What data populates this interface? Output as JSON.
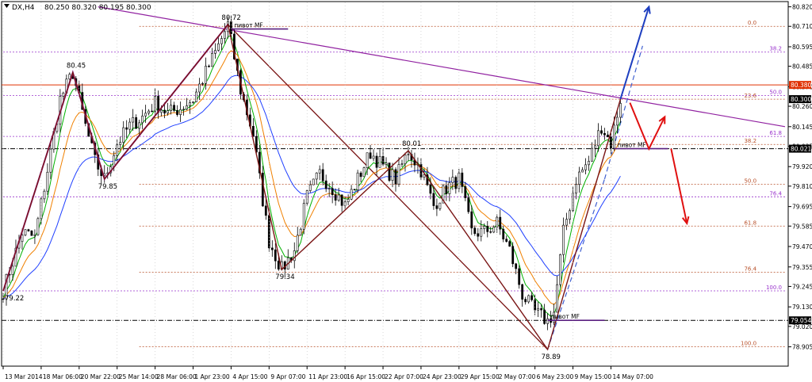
{
  "header": {
    "symbol": "DX,H4",
    "ohlc": "80.250 80.320 80.195 80.300"
  },
  "colors": {
    "background": "#ffffff",
    "candle": "#000000",
    "grid": "#c0c0c0",
    "ma_fast": "#00b000",
    "ma_mid": "#f08000",
    "ma_slow": "#2040ff",
    "zigzag": "#7a1515",
    "purple_line": "#9020a0",
    "fib_brown": "#b8502a",
    "fib_purple": "#9933cc",
    "red_level": "#e03000",
    "black_level": "#000000",
    "forecast_blue": "#1e3fc0",
    "forecast_red": "#e01010"
  },
  "chart_data": {
    "type": "candlestick",
    "title": "DX,H4",
    "ylim": [
      78.805,
      80.845
    ],
    "x_range": [
      0,
      247
    ],
    "y_ticks": [
      80.82,
      80.71,
      80.595,
      80.485,
      80.37,
      80.26,
      80.145,
      80.035,
      79.92,
      79.81,
      79.695,
      79.585,
      79.47,
      79.355,
      79.245,
      79.13,
      79.02,
      78.905,
      78.795
    ],
    "x_ticks": [
      {
        "x": 0,
        "label": "13 Mar 2014"
      },
      {
        "x": 12,
        "label": "18 Mar 06:00"
      },
      {
        "x": 24,
        "label": "20 Mar 22:00"
      },
      {
        "x": 36,
        "label": "25 Mar 14:00"
      },
      {
        "x": 48,
        "label": "28 Mar 06:00"
      },
      {
        "x": 60,
        "label": "1 Apr 23:00"
      },
      {
        "x": 72,
        "label": "4 Apr 15:00"
      },
      {
        "x": 84,
        "label": "9 Apr 07:00"
      },
      {
        "x": 96,
        "label": "11 Apr 23:00"
      },
      {
        "x": 108,
        "label": "16 Apr 15:00"
      },
      {
        "x": 120,
        "label": "22 Apr 07:00"
      },
      {
        "x": 132,
        "label": "24 Apr 23:00"
      },
      {
        "x": 144,
        "label": "29 Apr 15:00"
      },
      {
        "x": 156,
        "label": "2 May 07:00"
      },
      {
        "x": 168,
        "label": "6 May 23:00"
      },
      {
        "x": 180,
        "label": "9 May 15:00"
      },
      {
        "x": 192,
        "label": "14 May 07:00"
      }
    ],
    "price_tags": [
      {
        "value": 80.38,
        "label": "80.380",
        "bg": "#e03000",
        "fg": "#ffffff"
      },
      {
        "value": 80.3,
        "label": "80.300",
        "bg": "#000000",
        "fg": "#ffffff"
      },
      {
        "value": 80.021,
        "label": "80.021",
        "bg": "#000000",
        "fg": "#ffffff"
      },
      {
        "value": 79.054,
        "label": "79.054",
        "bg": "#000000",
        "fg": "#ffffff"
      }
    ],
    "swing_labels": [
      {
        "x": 0,
        "y": 79.22,
        "label": "79.22",
        "pos": "below"
      },
      {
        "x": 22,
        "y": 80.45,
        "label": "80.45",
        "pos": "above"
      },
      {
        "x": 32,
        "y": 79.85,
        "label": "79.85",
        "pos": "below"
      },
      {
        "x": 71,
        "y": 80.72,
        "label": "80.72",
        "pos": "above"
      },
      {
        "x": 88,
        "y": 79.34,
        "label": "79.34",
        "pos": "below"
      },
      {
        "x": 128,
        "y": 80.01,
        "label": "80.01",
        "pos": "above"
      },
      {
        "x": 172,
        "y": 78.89,
        "label": "78.89",
        "pos": "below"
      }
    ],
    "anchors": [
      [
        0,
        79.22
      ],
      [
        6,
        79.55
      ],
      [
        10,
        79.52
      ],
      [
        14,
        79.9
      ],
      [
        18,
        80.3
      ],
      [
        22,
        80.45
      ],
      [
        26,
        80.15
      ],
      [
        29,
        79.95
      ],
      [
        32,
        79.85
      ],
      [
        36,
        80.05
      ],
      [
        40,
        80.15
      ],
      [
        44,
        80.2
      ],
      [
        48,
        80.28
      ],
      [
        52,
        80.22
      ],
      [
        56,
        80.25
      ],
      [
        60,
        80.3
      ],
      [
        64,
        80.45
      ],
      [
        68,
        80.6
      ],
      [
        71,
        80.72
      ],
      [
        75,
        80.35
      ],
      [
        79,
        80.1
      ],
      [
        81,
        79.85
      ],
      [
        84,
        79.5
      ],
      [
        88,
        79.34
      ],
      [
        92,
        79.45
      ],
      [
        96,
        79.75
      ],
      [
        100,
        79.88
      ],
      [
        104,
        79.8
      ],
      [
        108,
        79.7
      ],
      [
        112,
        79.85
      ],
      [
        116,
        80.0
      ],
      [
        120,
        79.92
      ],
      [
        124,
        79.85
      ],
      [
        128,
        80.01
      ],
      [
        132,
        79.9
      ],
      [
        136,
        79.7
      ],
      [
        140,
        79.8
      ],
      [
        144,
        79.85
      ],
      [
        148,
        79.55
      ],
      [
        152,
        79.55
      ],
      [
        156,
        79.6
      ],
      [
        160,
        79.45
      ],
      [
        164,
        79.2
      ],
      [
        168,
        79.1
      ],
      [
        172,
        79.05
      ],
      [
        174,
        79.1
      ],
      [
        177,
        79.55
      ],
      [
        181,
        79.85
      ],
      [
        185,
        79.95
      ],
      [
        189,
        80.15
      ],
      [
        192,
        80.05
      ],
      [
        195,
        80.3
      ]
    ],
    "zigzag": [
      [
        0,
        79.22
      ],
      [
        22,
        80.45
      ],
      [
        32,
        79.85
      ],
      [
        71,
        80.72
      ],
      [
        88,
        79.34
      ],
      [
        128,
        80.01
      ],
      [
        172,
        78.89
      ],
      [
        195,
        80.3
      ]
    ],
    "purple_zigzag": [
      [
        0,
        79.22
      ],
      [
        22,
        80.45
      ],
      [
        32,
        79.85
      ],
      [
        71,
        80.72
      ]
    ],
    "extra_lines": [
      {
        "from": [
          71,
          80.72
        ],
        "to": [
          172,
          78.89
        ],
        "color": "#7a1515",
        "width": 1.3
      },
      {
        "from": [
          30,
          80.82
        ],
        "to": [
          247,
          80.145
        ],
        "color": "#9020a0",
        "width": 1.2
      },
      {
        "from": [
          172,
          78.89
        ],
        "to": [
          190,
          79.85
        ],
        "color": "#4060d0",
        "width": 1.2,
        "dash": "6 4"
      },
      {
        "from": [
          190,
          79.85
        ],
        "to": [
          202,
          80.6
        ],
        "color": "#4060d0",
        "width": 1.2,
        "dash": "6 4"
      }
    ],
    "pivots": [
      {
        "x1": 72,
        "x2": 90,
        "y": 80.695,
        "label": "пивот МF"
      },
      {
        "x1": 193,
        "x2": 210,
        "y": 80.021,
        "label": "пивот МF"
      },
      {
        "x1": 172,
        "x2": 190,
        "y": 79.054,
        "label": "пивот МF"
      }
    ],
    "fib_brown": {
      "x_start": 43,
      "x_label": 238,
      "levels": [
        {
          "value": 80.71,
          "label": "0.0"
        },
        {
          "value": 80.3,
          "label": "23.6"
        },
        {
          "value": 80.045,
          "label": "38.2"
        },
        {
          "value": 79.82,
          "label": "50.0"
        },
        {
          "value": 79.585,
          "label": "61.8"
        },
        {
          "value": 79.325,
          "label": "76.4"
        },
        {
          "value": 78.905,
          "label": "100.0"
        }
      ]
    },
    "fib_purple": {
      "x_start": 0,
      "x_label": 246,
      "levels": [
        {
          "value": 80.565,
          "label": "38.2"
        },
        {
          "value": 80.32,
          "label": "50.0"
        },
        {
          "value": 80.09,
          "label": "61.8"
        },
        {
          "value": 79.75,
          "label": "76.4"
        },
        {
          "value": 79.22,
          "label": "100.0"
        }
      ]
    },
    "hlines": [
      {
        "value": 80.38,
        "color": "#e03000",
        "style": "solid"
      },
      {
        "value": 80.021,
        "color": "#000000",
        "style": "dashdot"
      },
      {
        "value": 79.054,
        "color": "#000000",
        "style": "dashdot"
      }
    ],
    "arrows": [
      {
        "path": [
          [
            195,
            80.3
          ],
          [
            204,
            80.82
          ]
        ],
        "color": "#1e3fc0"
      },
      {
        "path": [
          [
            198,
            80.28
          ],
          [
            204,
            80.02
          ],
          [
            209,
            80.2
          ]
        ],
        "color": "#e01010"
      },
      {
        "path": [
          [
            211,
            80.021
          ],
          [
            216,
            79.6
          ]
        ],
        "color": "#e01010"
      }
    ]
  }
}
